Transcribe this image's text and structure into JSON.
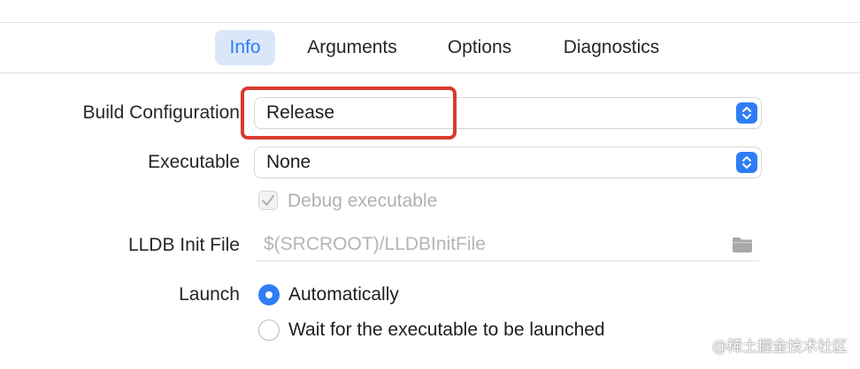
{
  "tabs": [
    {
      "label": "Info",
      "selected": true
    },
    {
      "label": "Arguments",
      "selected": false
    },
    {
      "label": "Options",
      "selected": false
    },
    {
      "label": "Diagnostics",
      "selected": false
    }
  ],
  "build_configuration": {
    "label": "Build Configuration",
    "value": "Release"
  },
  "executable": {
    "label": "Executable",
    "value": "None"
  },
  "debug_executable": {
    "label": "Debug executable",
    "checked": true,
    "enabled": false
  },
  "lldb_init_file": {
    "label": "LLDB Init File",
    "placeholder": "$(SRCROOT)/LLDBInitFile",
    "icon": "folder-icon"
  },
  "launch": {
    "label": "Launch",
    "options": [
      {
        "label": "Automatically",
        "selected": true
      },
      {
        "label": "Wait for the executable to be launched",
        "selected": false
      }
    ]
  },
  "annotation": {
    "color": "#d93a2e"
  },
  "watermark": {
    "text": "@稀土掘金技术社区"
  },
  "colors": {
    "accent": "#2f7df6",
    "selected_tab_bg": "#dbe7f8"
  }
}
